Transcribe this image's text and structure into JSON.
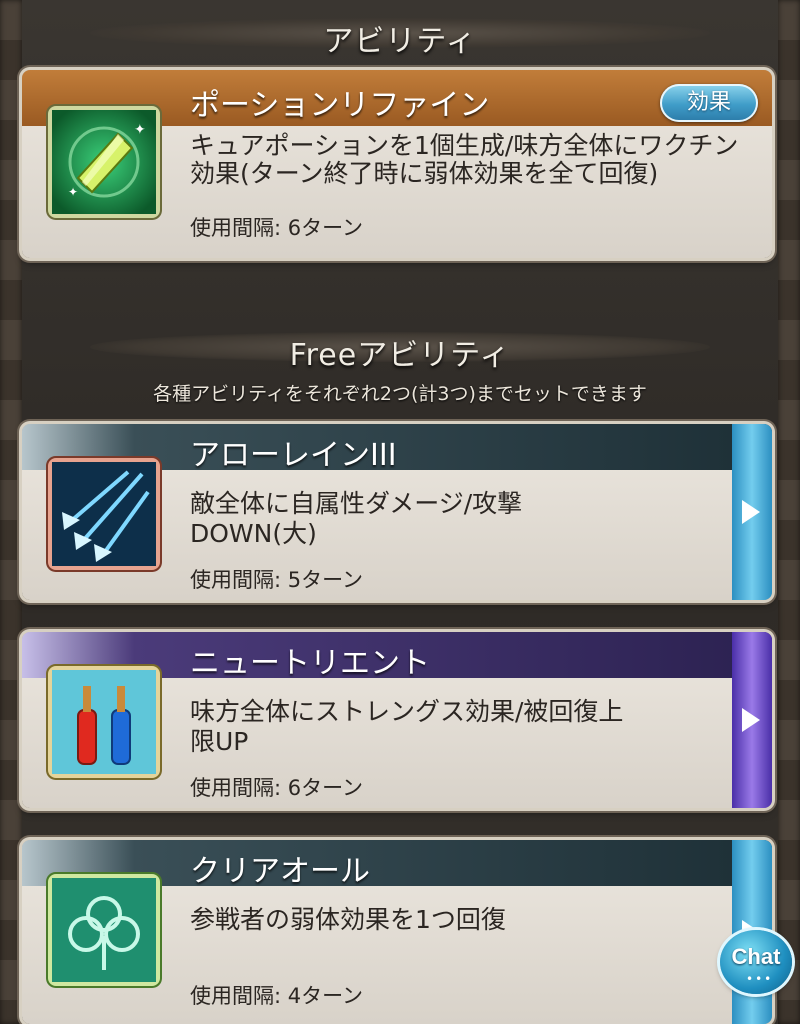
{
  "ability_section": {
    "title": "アビリティ"
  },
  "main_ability": {
    "name": "ポーションリファイン",
    "effect_button": "効果",
    "description": "キュアポーションを1個生成/味方全体にワクチン効果(ターン終了時に弱体効果を全て回復)",
    "description_lines": [
      "キュアポーションを1個生成/味方全体にワクチン",
      "効果(ターン終了時に弱体効果を全て回復)"
    ],
    "cooldown": "使用間隔: 6ターン",
    "icon": "potion-crystal-icon"
  },
  "free_section": {
    "title": "Freeアビリティ",
    "subtitle": "各種アビリティをそれぞれ2つ(計3つ)までセットできます"
  },
  "free_abilities": [
    {
      "name": "アローレインIII",
      "description_lines": [
        "敵全体に自属性ダメージ/攻撃",
        "DOWN(大)"
      ],
      "cooldown": "使用間隔: 5ターン",
      "icon": "arrow-rain-icon",
      "color": "#5ab3d9"
    },
    {
      "name": "ニュートリエント",
      "description_lines": [
        "味方全体にストレングス効果/被回復上",
        "限UP"
      ],
      "cooldown": "使用間隔: 6ターン",
      "icon": "ampoules-icon",
      "color": "#7a5ad0"
    },
    {
      "name": "クリアオール",
      "description_lines": [
        "参戦者の弱体効果を1つ回復",
        ""
      ],
      "cooldown": "使用間隔: 4ターン",
      "icon": "clover-leaf-icon",
      "color": "#5ab3d9"
    }
  ],
  "chat": {
    "label": "Chat",
    "dots": "•••"
  }
}
